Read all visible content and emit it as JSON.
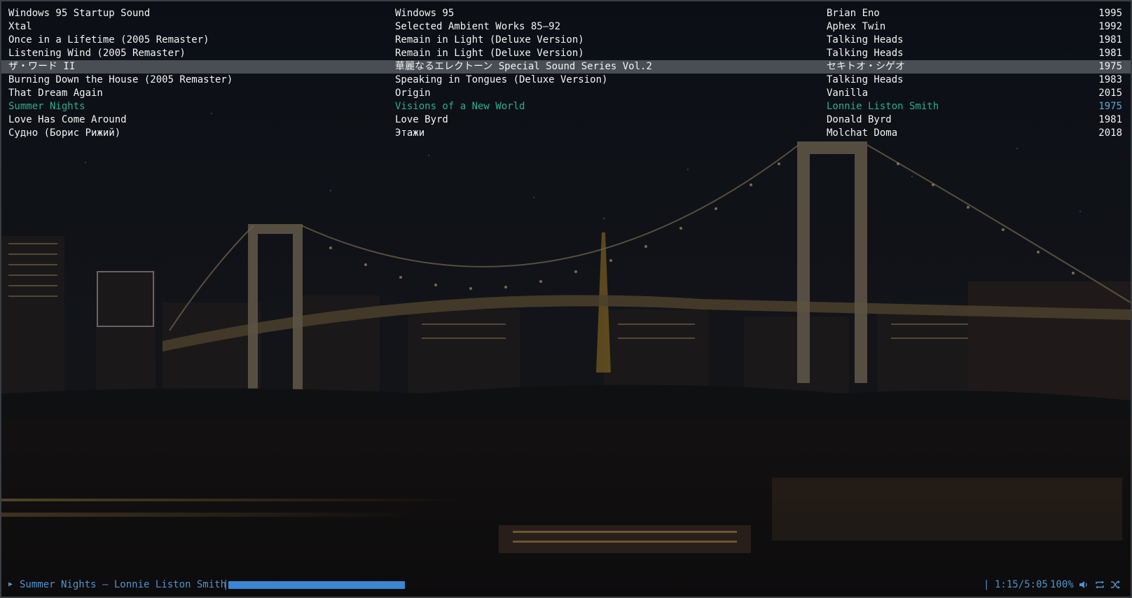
{
  "tracks": [
    {
      "title": "Windows 95 Startup Sound",
      "album": "Windows 95",
      "artist": "Brian Eno",
      "year": "1995"
    },
    {
      "title": "Xtal",
      "album": "Selected Ambient Works 85–92",
      "artist": "Aphex Twin",
      "year": "1992"
    },
    {
      "title": "Once in a Lifetime (2005 Remaster)",
      "album": "Remain in Light (Deluxe Version)",
      "artist": "Talking Heads",
      "year": "1981"
    },
    {
      "title": "Listening Wind (2005 Remaster)",
      "album": "Remain in Light (Deluxe Version)",
      "artist": "Talking Heads",
      "year": "1981"
    },
    {
      "title": "ザ・ワード II",
      "album": "華麗なるエレクトーン Special Sound Series Vol.2",
      "artist": "セキトオ・シゲオ",
      "year": "1975"
    },
    {
      "title": "Burning Down the House (2005 Remaster)",
      "album": "Speaking in Tongues (Deluxe Version)",
      "artist": "Talking Heads",
      "year": "1983"
    },
    {
      "title": "That Dream Again",
      "album": "Origin",
      "artist": "Vanilla",
      "year": "2015"
    },
    {
      "title": "Summer Nights",
      "album": "Visions of a New World",
      "artist": "Lonnie Liston Smith",
      "year": "1975"
    },
    {
      "title": "Love Has Come Around",
      "album": "Love Byrd",
      "artist": "Donald Byrd",
      "year": "1981"
    },
    {
      "title": "Судно (Борис Рижий)",
      "album": "Этажи",
      "artist": "Molchat Doma",
      "year": "2018"
    }
  ],
  "selected_index": 4,
  "playing_index": 7,
  "status": {
    "play_icon": "▶",
    "now_playing": "Summer Nights — Lonnie Liston Smith",
    "sep_left": "|",
    "progress": 0.238,
    "sep_right": "|",
    "time": "1:15/5:05",
    "volume": "100%",
    "icons": [
      "volume-icon",
      "repeat-icon",
      "shuffle-icon"
    ]
  },
  "colors": {
    "playing_text": "#26b08c",
    "status_text": "#4f93d0",
    "progress_fill": "#3a86d3",
    "selected_bg": "#5f656b"
  }
}
